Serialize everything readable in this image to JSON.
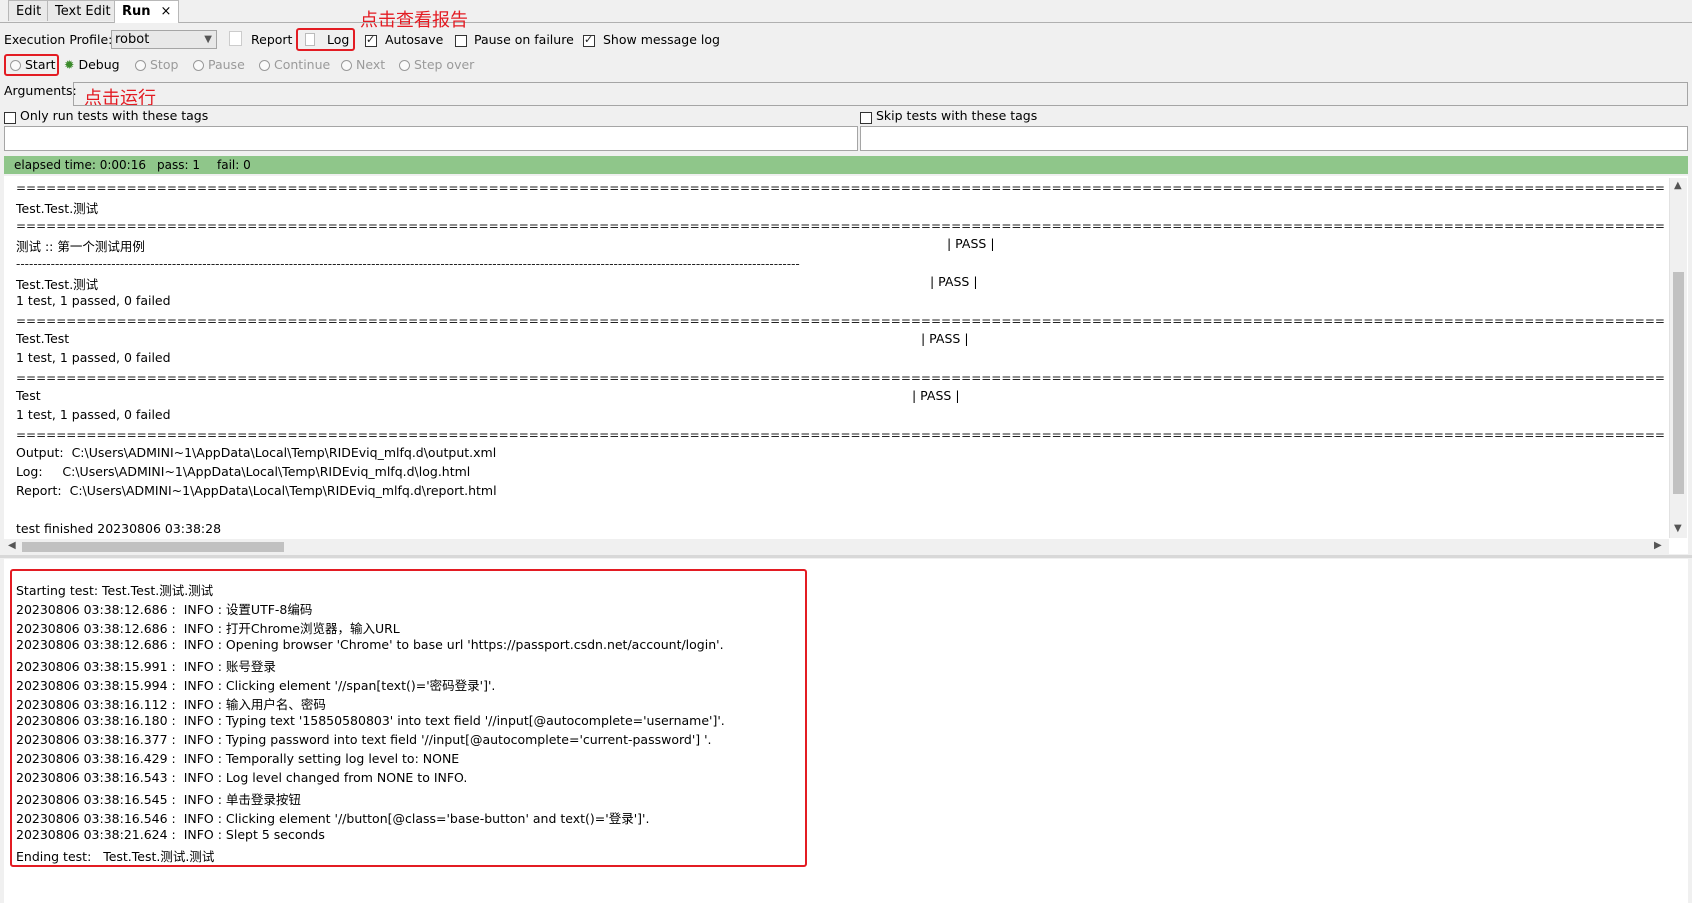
{
  "tabs": [
    {
      "label": "Edit"
    },
    {
      "label": "Text Edit"
    },
    {
      "label": "Run",
      "close": "×"
    }
  ],
  "toolbar": {
    "execution_profile_label": "Execution Profile:",
    "execution_profile_value": "robot",
    "report_label": "Report",
    "log_label": "Log",
    "autosave_label": "Autosave",
    "autosave_checked": true,
    "pause_on_failure_label": "Pause on failure",
    "pause_on_failure_checked": false,
    "show_message_log_label": "Show message log",
    "show_message_log_checked": true,
    "start_label": "Start",
    "debug_label": "Debug",
    "stop_label": "Stop",
    "pause_label": "Pause",
    "continue_label": "Continue",
    "next_label": "Next",
    "step_over_label": "Step over",
    "arguments_label": "Arguments:",
    "arguments_value": "",
    "only_run_tags_label": "Only run tests with these tags",
    "skip_tags_label": "Skip tests with these tags"
  },
  "annotations": {
    "view_report": "点击查看报告",
    "click_run": "点击运行"
  },
  "status": {
    "elapsed": "elapsed time: 0:00:16",
    "pass": "pass: 1",
    "fail": "fail: 0",
    "color": "#8fc68a"
  },
  "output": {
    "separator_eq": "==============================================================================================================================================================================================================================",
    "separator_dash": "-------------------------------------------------------------------------------------------------------------------------------------------------------------------------------------",
    "lines": [
      {
        "text": "Test.Test.测试"
      },
      {
        "text": "测试 :: 第一个测试用例",
        "status": "| PASS |"
      },
      {
        "text": "Test.Test.测试",
        "status": "| PASS |"
      },
      {
        "text": "1 test, 1 passed, 0 failed"
      },
      {
        "text": "Test.Test",
        "status": "| PASS |"
      },
      {
        "text": "1 test, 1 passed, 0 failed"
      },
      {
        "text": "Test",
        "status": "| PASS |"
      },
      {
        "text": "1 test, 1 passed, 0 failed"
      },
      {
        "text": "Output:  C:\\Users\\ADMINI~1\\AppData\\Local\\Temp\\RIDEviq_mlfq.d\\output.xml"
      },
      {
        "text": "Log:     C:\\Users\\ADMINI~1\\AppData\\Local\\Temp\\RIDEviq_mlfq.d\\log.html"
      },
      {
        "text": "Report:  C:\\Users\\ADMINI~1\\AppData\\Local\\Temp\\RIDEviq_mlfq.d\\report.html"
      },
      {
        "text": "test finished 20230806 03:38:28"
      }
    ]
  },
  "message_log": [
    "Starting test: Test.Test.测试.测试",
    "20230806 03:38:12.686 :  INFO : 设置UTF-8编码",
    "20230806 03:38:12.686 :  INFO : 打开Chrome浏览器，输入URL",
    "20230806 03:38:12.686 :  INFO : Opening browser 'Chrome' to base url 'https://passport.csdn.net/account/login'.",
    "20230806 03:38:15.991 :  INFO : 账号登录",
    "20230806 03:38:15.994 :  INFO : Clicking element '//span[text()='密码登录']'.",
    "20230806 03:38:16.112 :  INFO : 输入用户名、密码",
    "20230806 03:38:16.180 :  INFO : Typing text '15850580803' into text field '//input[@autocomplete='username']'.",
    "20230806 03:38:16.377 :  INFO : Typing password into text field '//input[@autocomplete='current-password'] '.",
    "20230806 03:38:16.429 :  INFO : Temporally setting log level to: NONE",
    "20230806 03:38:16.543 :  INFO : Log level changed from NONE to INFO.",
    "20230806 03:38:16.545 :  INFO : 单击登录按钮",
    "20230806 03:38:16.546 :  INFO : Clicking element '//button[@class='base-button' and text()='登录']'.",
    "20230806 03:38:21.624 :  INFO : Slept 5 seconds",
    "Ending test:   Test.Test.测试.测试"
  ]
}
